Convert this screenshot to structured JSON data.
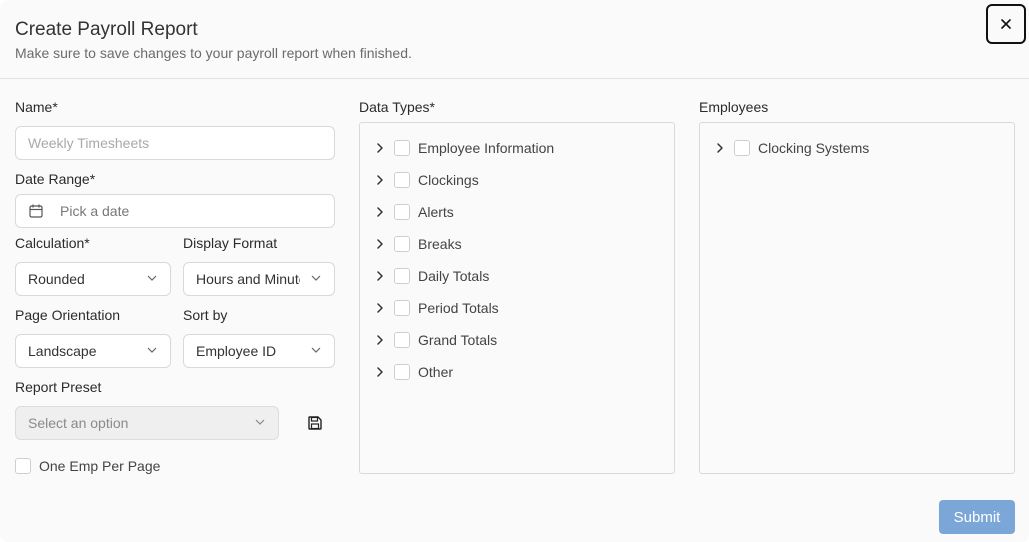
{
  "dialog": {
    "title": "Create Payroll Report",
    "subtitle": "Make sure to save changes to your payroll report when finished.",
    "close_icon": "close-icon"
  },
  "form": {
    "name_label": "Name*",
    "name_placeholder": "Weekly Timesheets",
    "date_range_label": "Date Range*",
    "date_placeholder": "Pick a date",
    "calculation_label": "Calculation*",
    "calculation_value": "Rounded",
    "display_format_label": "Display Format",
    "display_format_value": "Hours and Minutes",
    "page_orientation_label": "Page Orientation",
    "page_orientation_value": "Landscape",
    "sort_by_label": "Sort by",
    "sort_by_value": "Employee ID",
    "report_preset_label": "Report Preset",
    "report_preset_placeholder": "Select an option",
    "one_emp_label": "One Emp Per Page"
  },
  "data_types": {
    "label": "Data Types*",
    "items": [
      {
        "label": "Employee Information"
      },
      {
        "label": "Clockings"
      },
      {
        "label": "Alerts"
      },
      {
        "label": "Breaks"
      },
      {
        "label": "Daily Totals"
      },
      {
        "label": "Period Totals"
      },
      {
        "label": "Grand Totals"
      },
      {
        "label": "Other"
      }
    ]
  },
  "employees": {
    "label": "Employees",
    "items": [
      {
        "label": "Clocking Systems"
      }
    ]
  },
  "footer": {
    "submit_label": "Submit"
  },
  "colors": {
    "submit_bg": "#7ba7d8",
    "border": "#d9d9d9"
  }
}
